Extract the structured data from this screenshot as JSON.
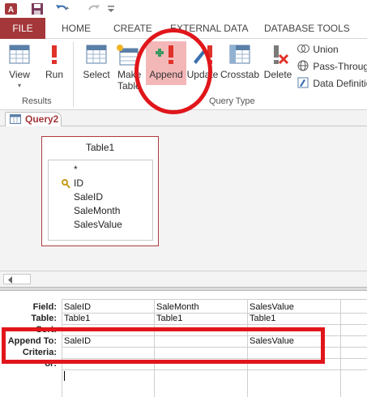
{
  "colors": {
    "accent": "#a4373a",
    "annotation": "#e0161b",
    "append_highlight": "#f4b7b8"
  },
  "qat": {
    "icons": [
      "access-logo-icon",
      "save-icon",
      "undo-icon",
      "redo-icon"
    ]
  },
  "tabs": {
    "file": "FILE",
    "home": "HOME",
    "create": "CREATE",
    "external_data": "EXTERNAL DATA",
    "database_tools": "DATABASE TOOLS"
  },
  "ribbon": {
    "results": {
      "view": "View",
      "run": "Run",
      "group_label": "Results"
    },
    "query_type": {
      "select": "Select",
      "make_table_1": "Make",
      "make_table_2": "Table",
      "append": "Append",
      "update": "Update",
      "crosstab": "Crosstab",
      "delete": "Delete",
      "union": "Union",
      "pass_through": "Pass-Through",
      "data_definition": "Data Definition",
      "group_label": "Query Type"
    }
  },
  "document_tab": {
    "label": "Query2"
  },
  "field_list": {
    "title": "Table1",
    "fields": [
      "*",
      "ID",
      "SaleID",
      "SaleMonth",
      "SalesValue"
    ]
  },
  "qbe_grid": {
    "row_labels": [
      "Field:",
      "Table:",
      "Sort:",
      "Append To:",
      "Criteria:",
      "or:"
    ],
    "columns": [
      {
        "field": "SaleID",
        "table": "Table1",
        "append_to": "SaleID"
      },
      {
        "field": "SaleMonth",
        "table": "Table1",
        "append_to": ""
      },
      {
        "field": "SalesValue",
        "table": "Table1",
        "append_to": "SalesValue"
      }
    ]
  }
}
